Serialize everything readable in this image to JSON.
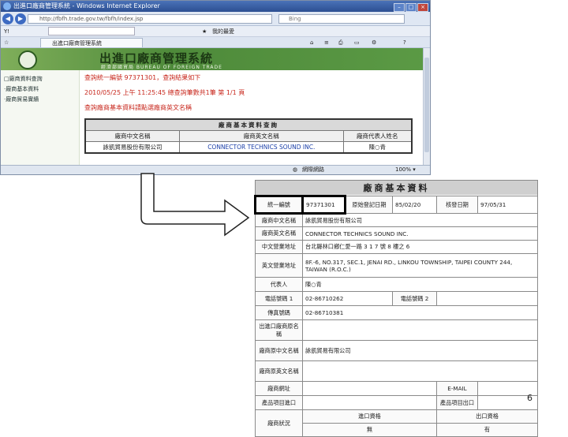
{
  "browser": {
    "window_title": "出進口廠商管理系統 - Windows Internet Explorer",
    "url": "http://fbfh.trade.gov.tw/fbfh/index.jsp",
    "search_placeholder": "Bing",
    "tab_title": "出進口廠商管理系統",
    "toolbar_label": "我的最愛",
    "status_text": "網際網路"
  },
  "site": {
    "title": "出進口廠商管理系統",
    "subtitle": "經濟部國貿局 BUREAU OF FOREIGN TRADE",
    "sidebar": [
      "□廠商資料查詢",
      "‧廠商基本資料",
      "‧廠商貿易實績"
    ],
    "result_line": "查詢統一編號 97371301，查詢結果如下",
    "time_line": "2010/05/25 上午 11:25:45 總查詢筆數共1筆 第 1/1 頁",
    "notice_line": "查詢廠商基本資料請點選廠商英文名稱",
    "mini_table": {
      "header": "廠商基本資料查詢",
      "columns": [
        "廠商中文名稱",
        "廠商英文名稱",
        "廠商代表人姓名"
      ],
      "row": [
        "詠凱貿易股份有限公司",
        "CONNECTOR TECHNICS SOUND INC.",
        "陳○青"
      ]
    }
  },
  "detail": {
    "title": "廠商基本資料",
    "uid_label": "統一編號",
    "uid_value": "97371301",
    "orig_reg_label": "原始登記日期",
    "orig_reg_value": "85/02/20",
    "verify_label": "核發日期",
    "verify_value": "97/05/31",
    "zh_name_label": "廠商中文名稱",
    "zh_name_value": "詠凱貿易股份有限公司",
    "en_name_label": "廠商英文名稱",
    "en_name_value": "CONNECTOR TECHNICS SOUND INC.",
    "zh_addr_label": "中文營業地址",
    "zh_addr_value": "台北縣林口鄉仁愛一路 3 1 7 號 8 樓之 6",
    "en_addr_label": "英文營業地址",
    "en_addr_value": "8F.-6, NO.317, SEC.1, JENAI RD., LINKOU TOWNSHIP, TAIPEI COUNTY 244, TAIWAN (R.O.C.)",
    "rep_label": "代表人",
    "rep_value": "陳○青",
    "phone1_label": "電話號碼 1",
    "phone1_value": "02-86710262",
    "phone2_label": "電話號碼 2",
    "phone2_value": "",
    "fax_label": "傳真號碼",
    "fax_value": "02-86710381",
    "prev_label": "出進口廠商原名稱",
    "prev_value": "",
    "old_zh_label": "廠商原中文名稱",
    "old_zh_value": "詠凱貿易有限公司",
    "old_en_label": "廠商原英文名稱",
    "old_en_value": "",
    "web_label": "廠商網址",
    "web_value": "",
    "email_label": "E-MAIL",
    "email_value": "",
    "import_label": "產品項目進口",
    "import_value": "",
    "export_label": "產品項目出口",
    "export_value": "",
    "status_label": "廠商狀況",
    "import_qual_label": "進口資格",
    "import_qual_value": "無",
    "export_qual_label": "出口資格",
    "export_qual_value": "有"
  },
  "page_number": "6"
}
